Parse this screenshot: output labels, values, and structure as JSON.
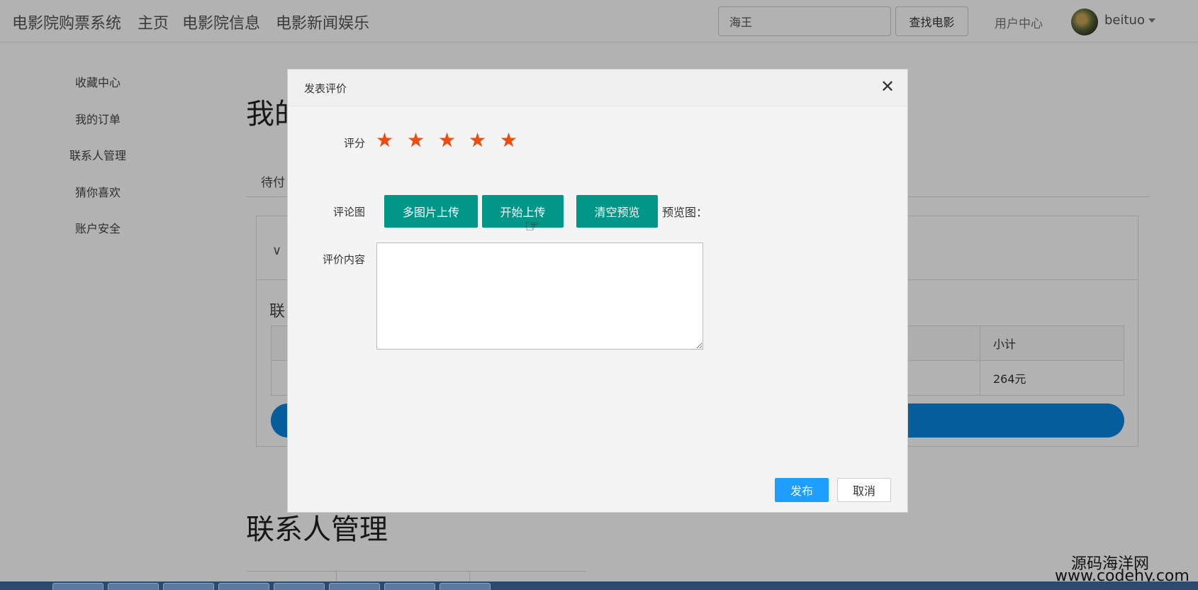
{
  "navbar": {
    "brand": "电影院购票系统",
    "links": [
      "主页",
      "电影院信息",
      "电影新闻娱乐"
    ],
    "search_value": "海王",
    "search_button": "查找电影",
    "user_center": "用户中心",
    "username": "beituo"
  },
  "sidebar": {
    "items": [
      {
        "label": "收藏中心"
      },
      {
        "label": "我的订单"
      },
      {
        "label": "联系人管理"
      },
      {
        "label": "猜你喜欢"
      },
      {
        "label": "账户安全"
      }
    ]
  },
  "main": {
    "page_title": "我的",
    "tab_label": "待付",
    "section_label": "联",
    "table": {
      "header_last": "小计",
      "row_last": "264元"
    },
    "bottom_title": "联系人管理"
  },
  "modal": {
    "title": "发表评价",
    "rating_label": "评分",
    "rating_value": 5,
    "rating_max": 5,
    "image_label": "评论图",
    "buttons": {
      "multi_upload": "多图片上传",
      "start_upload": "开始上传",
      "clear_preview": "清空预览"
    },
    "preview_label": "预览图：",
    "content_label": "评价内容",
    "content_value": "",
    "publish": "发布",
    "cancel": "取消"
  },
  "watermark": {
    "line1": "源码海洋网",
    "line2": "www.codehy.com"
  },
  "colors": {
    "teal": "#009688",
    "star": "#ee4b0e",
    "primary_blue": "#1e9fff",
    "pay_bar": "#0a86e0"
  }
}
